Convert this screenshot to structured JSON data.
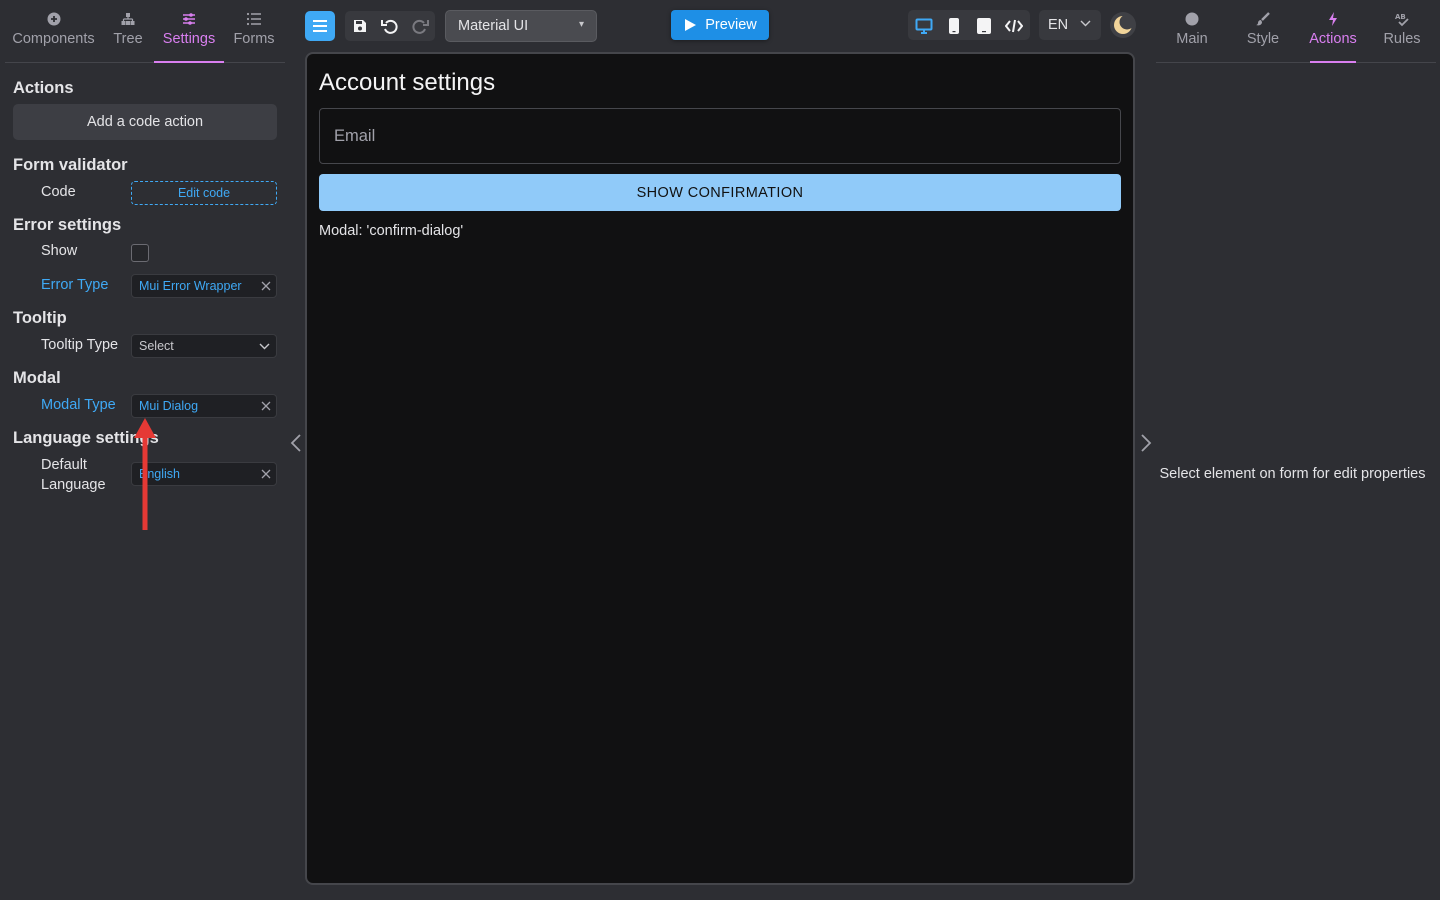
{
  "left_tabs": [
    {
      "label": "Components",
      "icon": "plus-circle-icon"
    },
    {
      "label": "Tree",
      "icon": "tree-icon"
    },
    {
      "label": "Settings",
      "icon": "sliders-icon",
      "active": true
    },
    {
      "label": "Forms",
      "icon": "list-icon"
    }
  ],
  "actions": {
    "title": "Actions",
    "add_label": "Add a code action"
  },
  "form_validator": {
    "title": "Form validator",
    "code_label": "Code",
    "edit_label": "Edit code"
  },
  "error_settings": {
    "title": "Error settings",
    "show_label": "Show",
    "show_checked": false,
    "type_label": "Error Type",
    "type_value": "Mui Error Wrapper"
  },
  "tooltip": {
    "title": "Tooltip",
    "type_label": "Tooltip Type",
    "type_placeholder": "Select"
  },
  "modal": {
    "title": "Modal",
    "type_label": "Modal Type",
    "type_value": "Mui Dialog"
  },
  "language_settings": {
    "title": "Language settings",
    "default_label": "Default Language",
    "default_value": "English"
  },
  "toolbar": {
    "theme_value": "Material UI",
    "preview_label": "Preview",
    "language": "EN",
    "accent": "#3fa9f5"
  },
  "canvas": {
    "title": "Account settings",
    "email_label": "Email",
    "button_label": "SHOW CONFIRMATION",
    "modal_text": "Modal: 'confirm-dialog'"
  },
  "right_tabs": [
    {
      "label": "Main",
      "icon": "circle-icon"
    },
    {
      "label": "Style",
      "icon": "brush-icon"
    },
    {
      "label": "Actions",
      "icon": "lightning-icon",
      "active": true
    },
    {
      "label": "Rules",
      "icon": "rules-icon"
    }
  ],
  "right_panel": {
    "empty_message": "Select element on form for edit properties"
  }
}
